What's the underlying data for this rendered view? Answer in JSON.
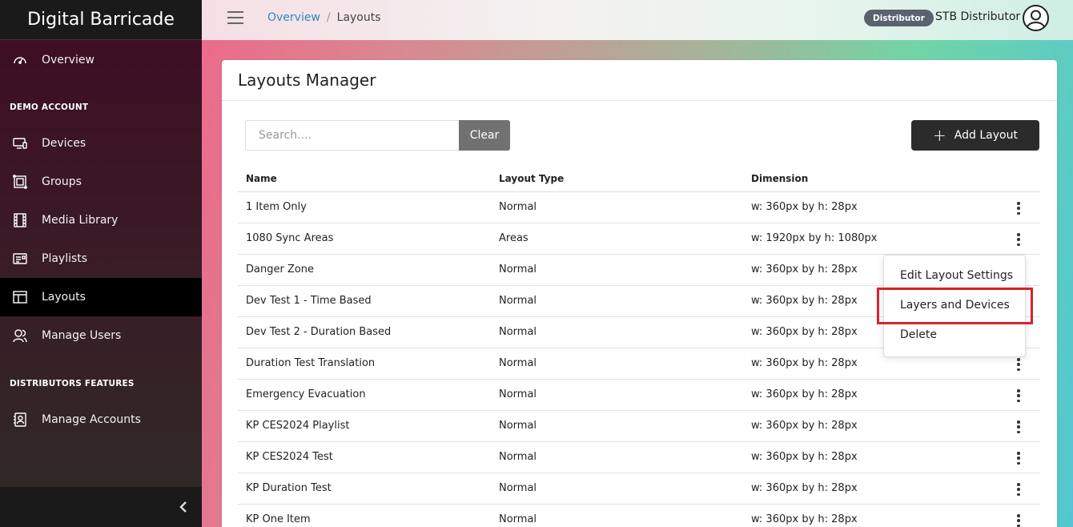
{
  "app": {
    "title": "Digital Barricade"
  },
  "sidebar": {
    "items": [
      {
        "label": "Overview",
        "icon": "dashboard-gauge-icon"
      },
      {
        "label": "Devices",
        "icon": "monitor-icon"
      },
      {
        "label": "Groups",
        "icon": "group-icon"
      },
      {
        "label": "Media Library",
        "icon": "film-icon"
      },
      {
        "label": "Playlists",
        "icon": "playlist-icon"
      },
      {
        "label": "Layouts",
        "icon": "layout-icon",
        "active": true
      },
      {
        "label": "Manage Users",
        "icon": "users-icon"
      },
      {
        "label": "Manage Accounts",
        "icon": "accounts-icon"
      }
    ],
    "sections": [
      "DEMO ACCOUNT",
      "DISTRIBUTORS FEATURES"
    ],
    "collapse_icon": "chevron-left-icon"
  },
  "header": {
    "breadcrumb": {
      "link": "Overview",
      "separator": "/",
      "current": "Layouts"
    },
    "role_badge": "Distributor",
    "username": "STB Distributor"
  },
  "page": {
    "title": "Layouts Manager",
    "search_placeholder": "Search....",
    "clear_label": "Clear",
    "add_label": "Add Layout"
  },
  "table": {
    "columns": [
      "Name",
      "Layout Type",
      "Dimension"
    ],
    "rows": [
      {
        "name": "1 Item Only",
        "type": "Normal",
        "dimension": "w: 360px by h: 28px"
      },
      {
        "name": "1080 Sync Areas",
        "type": "Areas",
        "dimension": "w: 1920px by h: 1080px"
      },
      {
        "name": "Danger Zone",
        "type": "Normal",
        "dimension": "w: 360px by h: 28px"
      },
      {
        "name": "Dev Test 1 - Time Based",
        "type": "Normal",
        "dimension": "w: 360px by h: 28px"
      },
      {
        "name": "Dev Test 2 - Duration Based",
        "type": "Normal",
        "dimension": "w: 360px by h: 28px"
      },
      {
        "name": "Duration Test Translation",
        "type": "Normal",
        "dimension": "w: 360px by h: 28px"
      },
      {
        "name": "Emergency Evacuation",
        "type": "Normal",
        "dimension": "w: 360px by h: 28px"
      },
      {
        "name": "KP CES2024 Playlist",
        "type": "Normal",
        "dimension": "w: 360px by h: 28px"
      },
      {
        "name": "KP CES2024 Test",
        "type": "Normal",
        "dimension": "w: 360px by h: 28px"
      },
      {
        "name": "KP Duration Test",
        "type": "Normal",
        "dimension": "w: 360px by h: 28px"
      },
      {
        "name": "KP One Item",
        "type": "Normal",
        "dimension": "w: 360px by h: 28px"
      }
    ]
  },
  "dropdown": {
    "items": [
      "Edit Layout Settings",
      "Layers and Devices",
      "Delete"
    ],
    "highlighted": "Layers and Devices",
    "highlight_color": "#d9232d"
  }
}
